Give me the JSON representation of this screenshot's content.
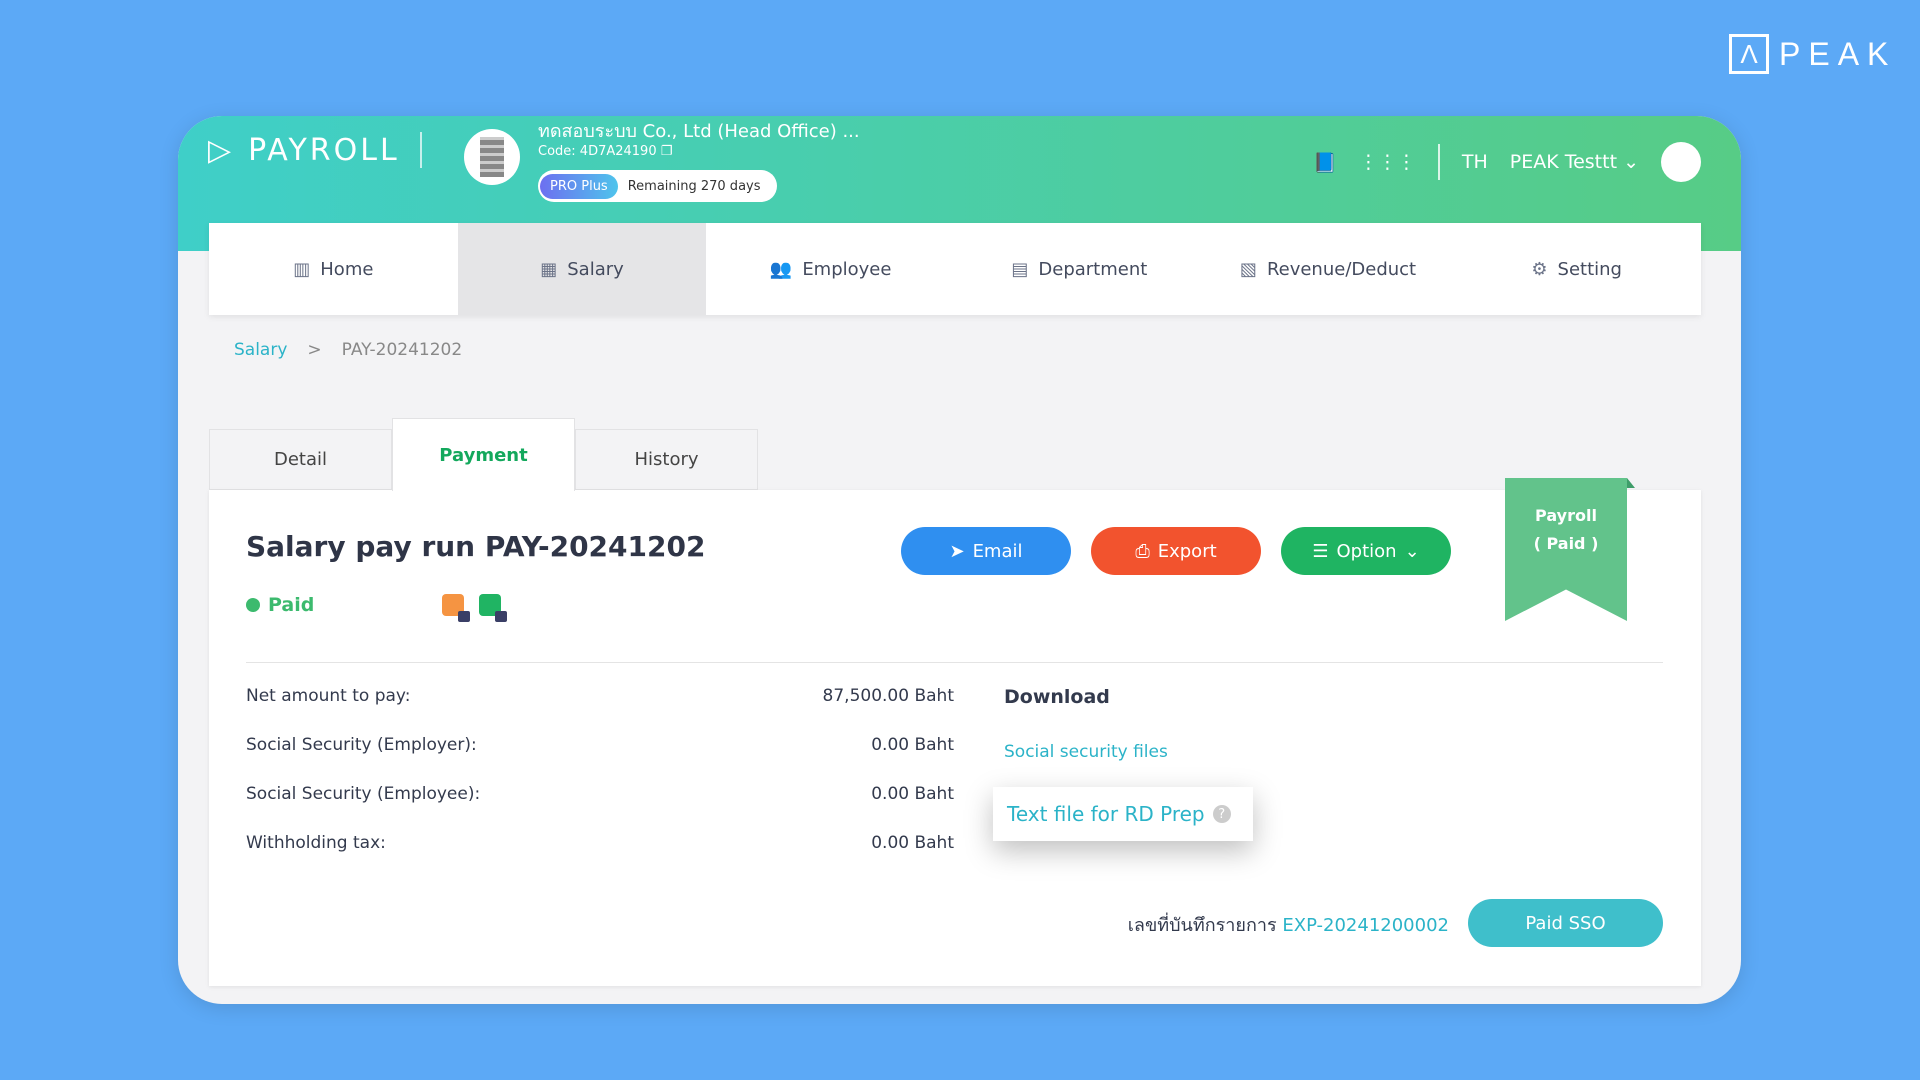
{
  "brand": {
    "logo_text": "PEAK",
    "app_name": "PAYROLL"
  },
  "company": {
    "name": "ทดสอบระบบ Co., Ltd (Head Office) ...",
    "code": "Code: 4D7A24190",
    "plan": "PRO Plus",
    "remaining": "Remaining 270 days"
  },
  "header": {
    "language": "TH",
    "user": "PEAK Testtt"
  },
  "nav": [
    {
      "label": "Home",
      "icon": "chart-icon"
    },
    {
      "label": "Salary",
      "icon": "calculator-icon",
      "active": true
    },
    {
      "label": "Employee",
      "icon": "users-icon"
    },
    {
      "label": "Department",
      "icon": "id-card-icon"
    },
    {
      "label": "Revenue/Deduct",
      "icon": "ledger-icon"
    },
    {
      "label": "Setting",
      "icon": "gear-icon"
    }
  ],
  "breadcrumb": {
    "root": "Salary",
    "sep": ">",
    "current": "PAY-20241202"
  },
  "tabs": [
    {
      "label": "Detail"
    },
    {
      "label": "Payment",
      "active": true
    },
    {
      "label": "History"
    }
  ],
  "payrun": {
    "title": "Salary pay run PAY-20241202",
    "status": "Paid",
    "ribbon_line1": "Payroll",
    "ribbon_line2": "( Paid )"
  },
  "actions": {
    "email": "Email",
    "export": "Export",
    "option": "Option"
  },
  "summary": [
    {
      "label": "Net amount to pay:",
      "value": "87,500.00 Baht"
    },
    {
      "label": "Social Security (Employer):",
      "value": "0.00 Baht"
    },
    {
      "label": "Social Security (Employee):",
      "value": "0.00 Baht"
    },
    {
      "label": "Withholding tax:",
      "value": "0.00 Baht"
    }
  ],
  "download": {
    "title": "Download",
    "social_security": "Social security files",
    "rd_prep": "Text file for RD Prep",
    "help": "?"
  },
  "footer": {
    "ref_label": "เลขที่บันทึกรายการ",
    "ref_value": "EXP-20241200002",
    "paid_sso": "Paid SSO"
  },
  "colors": {
    "email": "#2f8ff0",
    "export": "#f2532e",
    "option": "#1fb462",
    "accent": "#2bb3c8",
    "paid": "#3cba6e"
  }
}
